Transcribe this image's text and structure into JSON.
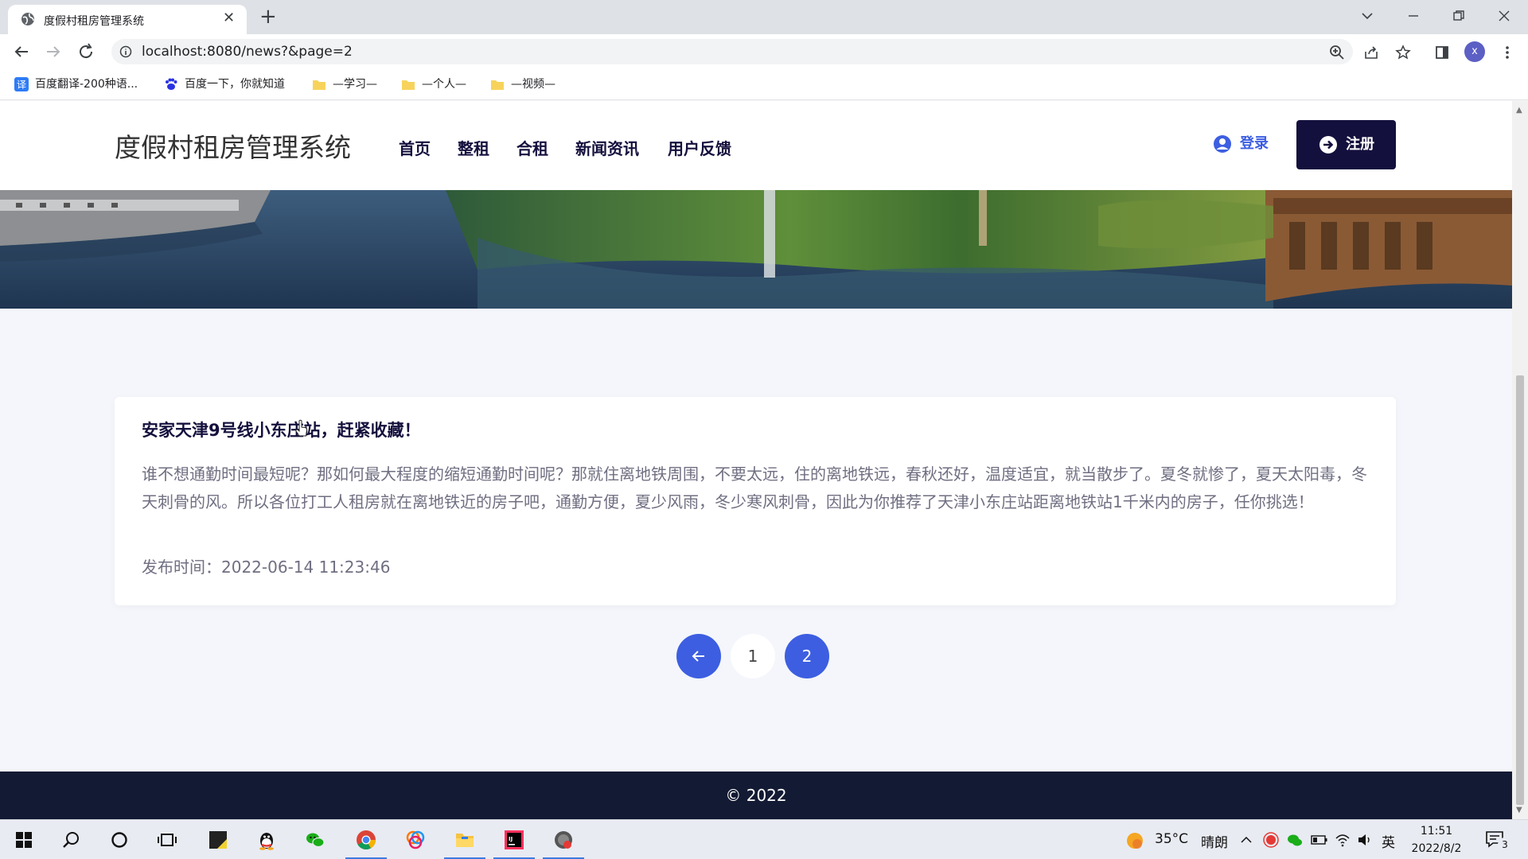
{
  "browser": {
    "tab_title": "度假村租房管理系统",
    "url": "localhost:8080/news?&page=2",
    "profile_initial": "x",
    "bookmarks": [
      {
        "label": "百度翻译-200种语...",
        "icon": "translate-icon"
      },
      {
        "label": "百度一下，你就知道",
        "icon": "baidu-paw-icon"
      },
      {
        "label": "—学习—",
        "icon": "folder-icon"
      },
      {
        "label": "—个人—",
        "icon": "folder-icon"
      },
      {
        "label": "—视频—",
        "icon": "folder-icon"
      }
    ]
  },
  "site": {
    "brand": "度假村租房管理系统",
    "menu": [
      "首页",
      "整租",
      "合租",
      "新闻资讯",
      "用户反馈"
    ],
    "login_label": "登录",
    "register_label": "注册",
    "accent_color": "#3d5ee1",
    "dark_color": "#14103d"
  },
  "news": {
    "title": "安家天津9号线小东庄站，赶紧收藏！",
    "body": "谁不想通勤时间最短呢？那如何最大程度的缩短通勤时间呢？那就住离地铁周围，不要太远，住的离地铁远，春秋还好，温度适宜，就当散步了。夏冬就惨了，夏天太阳毒，冬天刺骨的风。所以各位打工人租房就在离地铁近的房子吧，通勤方便，夏少风雨，冬少寒风刺骨，因此为你推荐了天津小东庄站距离地铁站1千米内的房子，任你挑选！",
    "date_label": "发布时间：",
    "date_value": "2022-06-14 11:23:46"
  },
  "pagination": {
    "pages": [
      "1",
      "2"
    ],
    "current_page": "2"
  },
  "footer": {
    "copyright": "© 2022"
  },
  "taskbar": {
    "weather_temp": "35°C",
    "weather_desc": "晴朗",
    "ime": "英",
    "time": "11:51",
    "date": "2022/8/2",
    "notification_count": "3"
  }
}
